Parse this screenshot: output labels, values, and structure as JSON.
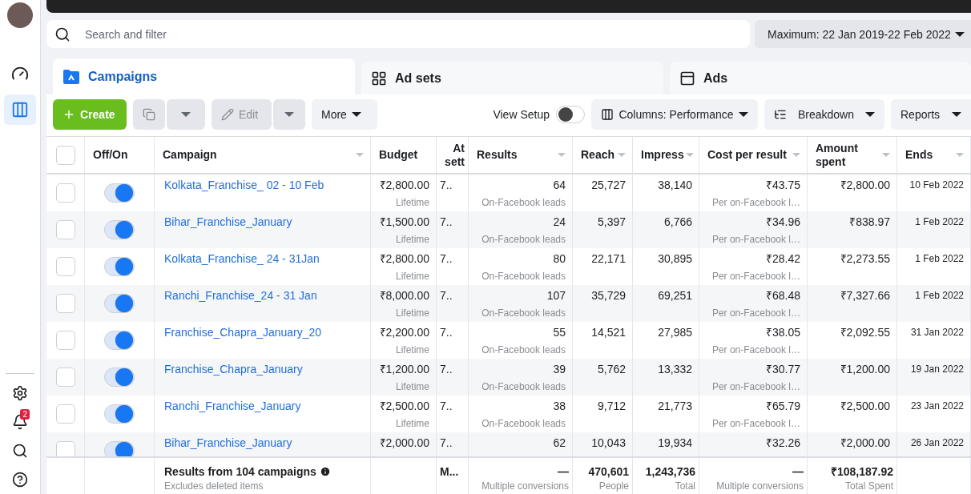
{
  "sidebar": {
    "top_items": [
      {
        "kind": "dashboard",
        "selected": false
      },
      {
        "kind": "table",
        "selected": true
      }
    ],
    "bottom_items": [
      {
        "kind": "settings"
      },
      {
        "kind": "notifications",
        "badge": "2"
      },
      {
        "kind": "search"
      },
      {
        "kind": "help"
      }
    ]
  },
  "search": {
    "placeholder": "Search and filter"
  },
  "date_range": {
    "label": "Maximum: 22 Jan 2019-22 Feb 2022"
  },
  "tabs": [
    {
      "kind": "campaigns",
      "label": "Campaigns",
      "selected": true
    },
    {
      "kind": "adsets",
      "label": "Ad sets",
      "selected": false
    },
    {
      "kind": "ads",
      "label": "Ads",
      "selected": false
    }
  ],
  "toolbar": {
    "create": "Create",
    "duplicate_disabled": true,
    "edit": "Edit",
    "edit_disabled": true,
    "more": "More",
    "view_setup": {
      "label": "View Setup",
      "on": false
    },
    "columns": "Columns: Performance",
    "breakdown": "Breakdown",
    "reports": "Reports"
  },
  "table": {
    "all_checked": false,
    "columns": [
      {
        "label": "Off/On",
        "sortable": false
      },
      {
        "label": "Campaign",
        "sortable": true
      },
      {
        "label": "Budget",
        "sortable": false
      },
      {
        "label": "At sett",
        "sortable": false
      },
      {
        "label": "Results",
        "sortable": true
      },
      {
        "label": "Reach",
        "sortable": true
      },
      {
        "label": "Impress",
        "sortable": true
      },
      {
        "label": "Cost per result",
        "sortable": true
      },
      {
        "label": "Amount spent",
        "sortable": true
      },
      {
        "label": "Ends",
        "sortable": true
      }
    ],
    "rows": [
      {
        "checked": false,
        "on": true,
        "campaign": "Kolkata_Franchise_ 02 - 10 Feb",
        "budget": "₹2,800.00",
        "budget_type": "Lifetime",
        "attribution": "7..",
        "results": "64",
        "result_type": "On-Facebook leads",
        "reach": "25,727",
        "impressions": "38,140",
        "cost_per_result": "₹43.75",
        "cost_type": "Per on-Facebook l…",
        "amount_spent": "₹2,800.00",
        "ends": "10 Feb 2022"
      },
      {
        "checked": false,
        "on": true,
        "campaign": "Bihar_Franchise_January",
        "budget": "₹1,500.00",
        "budget_type": "Lifetime",
        "attribution": "7..",
        "results": "24",
        "result_type": "On-Facebook leads",
        "reach": "5,397",
        "impressions": "6,766",
        "cost_per_result": "₹34.96",
        "cost_type": "Per on-Facebook l…",
        "amount_spent": "₹838.97",
        "ends": "1 Feb 2022"
      },
      {
        "checked": false,
        "on": true,
        "campaign": "Kolkata_Franchise_ 24 - 31Jan",
        "budget": "₹2,800.00",
        "budget_type": "Lifetime",
        "attribution": "7..",
        "results": "80",
        "result_type": "On-Facebook leads",
        "reach": "22,171",
        "impressions": "30,895",
        "cost_per_result": "₹28.42",
        "cost_type": "Per on-Facebook l…",
        "amount_spent": "₹2,273.55",
        "ends": "1 Feb 2022"
      },
      {
        "checked": false,
        "on": true,
        "campaign": "Ranchi_Franchise_24 - 31 Jan",
        "budget": "₹8,000.00",
        "budget_type": "Lifetime",
        "attribution": "7..",
        "results": "107",
        "result_type": "On-Facebook leads",
        "reach": "35,729",
        "impressions": "69,251",
        "cost_per_result": "₹68.48",
        "cost_type": "Per on-Facebook l…",
        "amount_spent": "₹7,327.66",
        "ends": "1 Feb 2022"
      },
      {
        "checked": false,
        "on": true,
        "campaign": "Franchise_Chapra_January_20",
        "budget": "₹2,200.00",
        "budget_type": "Lifetime",
        "attribution": "7..",
        "results": "55",
        "result_type": "On-Facebook leads",
        "reach": "14,521",
        "impressions": "27,985",
        "cost_per_result": "₹38.05",
        "cost_type": "Per on-Facebook l…",
        "amount_spent": "₹2,092.55",
        "ends": "31 Jan 2022"
      },
      {
        "checked": false,
        "on": true,
        "campaign": "Franchise_Chapra_January",
        "budget": "₹1,200.00",
        "budget_type": "Lifetime",
        "attribution": "7..",
        "results": "39",
        "result_type": "On-Facebook leads",
        "reach": "5,762",
        "impressions": "13,332",
        "cost_per_result": "₹30.77",
        "cost_type": "Per on-Facebook l…",
        "amount_spent": "₹1,200.00",
        "ends": "19 Jan 2022"
      },
      {
        "checked": false,
        "on": true,
        "campaign": "Ranchi_Franchise_January",
        "budget": "₹2,500.00",
        "budget_type": "Lifetime",
        "attribution": "7..",
        "results": "38",
        "result_type": "On-Facebook leads",
        "reach": "9,712",
        "impressions": "21,773",
        "cost_per_result": "₹65.79",
        "cost_type": "Per on-Facebook l…",
        "amount_spent": "₹2,500.00",
        "ends": "23 Jan 2022"
      },
      {
        "checked": false,
        "on": true,
        "campaign": "Bihar_Franchise_January",
        "budget": "₹2,000.00",
        "attribution": "7..",
        "results": "62",
        "reach": "10,043",
        "impressions": "19,934",
        "cost_per_result": "₹32.26",
        "amount_spent": "₹2,000.00",
        "ends": "26 Jan 2022"
      }
    ],
    "summary": {
      "title": "Results from 104 campaigns",
      "note": "Excludes deleted items",
      "attribution": "M...",
      "results": "—",
      "results_note": "Multiple conversions",
      "reach": "470,601",
      "reach_note": "People",
      "impressions": "1,243,736",
      "impressions_note": "Total",
      "cost_per_result": "—",
      "cost_note": "Multiple conversions",
      "amount_spent": "₹108,187.92",
      "amount_note": "Total Spent"
    }
  }
}
